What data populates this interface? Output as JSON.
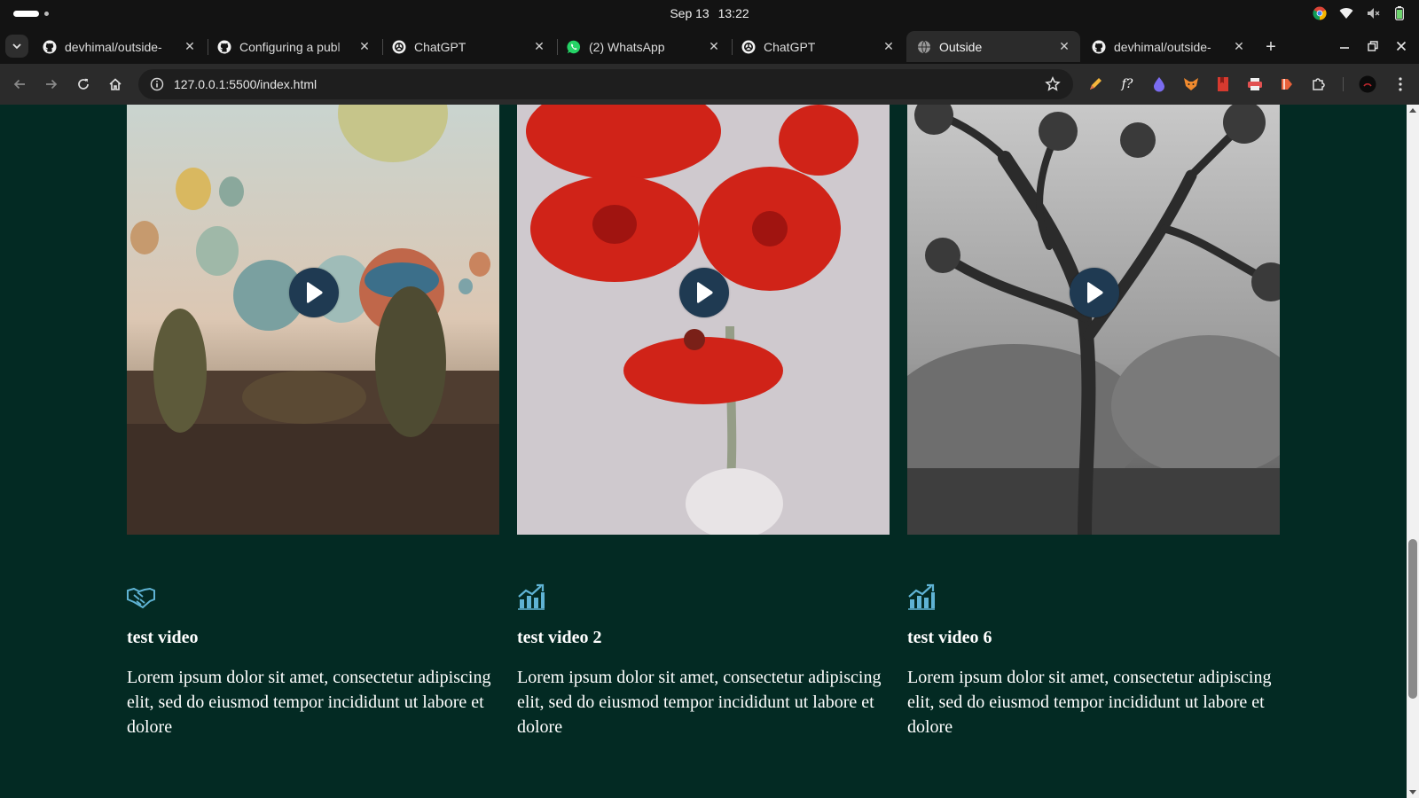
{
  "os": {
    "date": "Sep 13",
    "time": "13:22",
    "tray_icons": [
      "chrome-icon",
      "wifi-icon",
      "volume-muted-icon",
      "battery-icon"
    ]
  },
  "browser": {
    "tabs": [
      {
        "title": "devhimal/outside-",
        "favicon": "github-icon",
        "active": false
      },
      {
        "title": "Configuring a publ",
        "favicon": "github-icon",
        "active": false
      },
      {
        "title": "ChatGPT",
        "favicon": "openai-icon",
        "active": false
      },
      {
        "title": "(2) WhatsApp",
        "favicon": "whatsapp-icon",
        "active": false
      },
      {
        "title": "ChatGPT",
        "favicon": "openai-icon",
        "active": false
      },
      {
        "title": "Outside",
        "favicon": "globe-icon",
        "active": true
      },
      {
        "title": "devhimal/outside-",
        "favicon": "github-icon",
        "active": false
      }
    ],
    "new_tab_label": "+",
    "url": "127.0.0.1:5500/index.html",
    "extensions": [
      "pen-icon",
      "formula-icon",
      "drop-icon",
      "fox-icon",
      "bookmark-icon",
      "printer-icon",
      "share-icon",
      "puzzle-icon"
    ]
  },
  "cards": [
    {
      "image": "hot-air-balloons",
      "icon": "handshake-icon",
      "title": "test video",
      "description": "Lorem ipsum dolor sit amet, consectetur adipiscing elit, sed do eiusmod tempor incididunt ut labore et dolore"
    },
    {
      "image": "red-flowers",
      "icon": "chart-growth-icon",
      "title": "test video 2",
      "description": "Lorem ipsum dolor sit amet, consectetur adipiscing elit, sed do eiusmod tempor incididunt ut labore et dolore"
    },
    {
      "image": "joshua-trees",
      "icon": "chart-growth-icon",
      "title": "test video 6",
      "description": "Lorem ipsum dolor sit amet, consectetur adipiscing elit, sed do eiusmod tempor incididunt ut labore et dolore"
    }
  ],
  "colors": {
    "page_background": "#032a23",
    "icon_accent": "#5fb3d4",
    "play_button": "#1f3a52",
    "text": "#ffffff"
  }
}
